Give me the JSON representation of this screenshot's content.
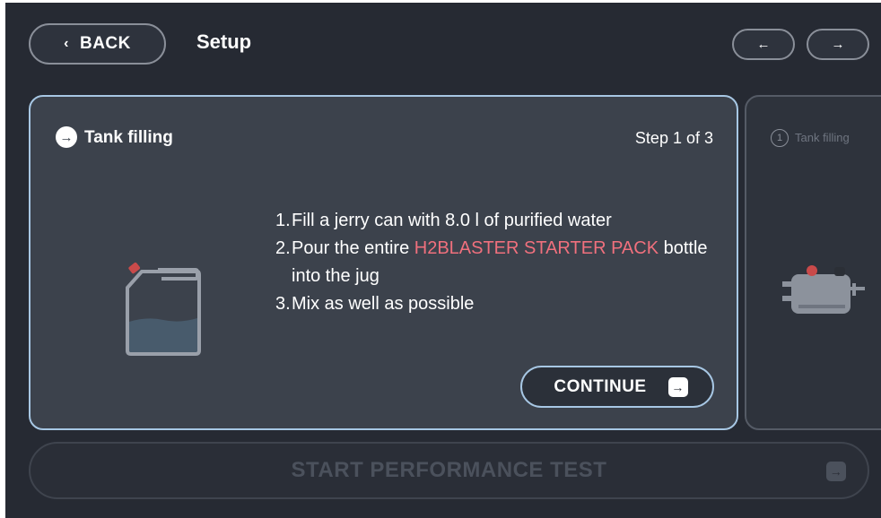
{
  "header": {
    "back_label": "BACK",
    "back_chevron": "‹",
    "title": "Setup",
    "prev_arrow": "←",
    "next_arrow": "→"
  },
  "current_card": {
    "head_icon": "→",
    "title": "Tank filling",
    "step_label": "Step 1 of 3",
    "instructions": [
      {
        "num": "1.",
        "text": "Fill a jerry can with 8.0 l of purified water"
      },
      {
        "num": "2.",
        "text_before": "Pour the entire ",
        "highlight": "H2BLASTER STARTER PACK",
        "text_after": " bottle into the jug"
      },
      {
        "num": "3.",
        "text": "Mix as well as possible"
      }
    ],
    "continue_label": "CONTINUE",
    "continue_icon": "→",
    "image_icon": "jerry-can-icon"
  },
  "next_card": {
    "step_number": "1",
    "title": "Tank filling",
    "image_icon": "water-tank-device-icon"
  },
  "start_test": {
    "label": "START PERFORMANCE TEST",
    "icon": "→"
  },
  "colors": {
    "background": "#262a33",
    "card": "#3c424c",
    "card_border": "#a7c7e4",
    "highlight": "#f0707d",
    "disabled_text": "#4b515c"
  }
}
